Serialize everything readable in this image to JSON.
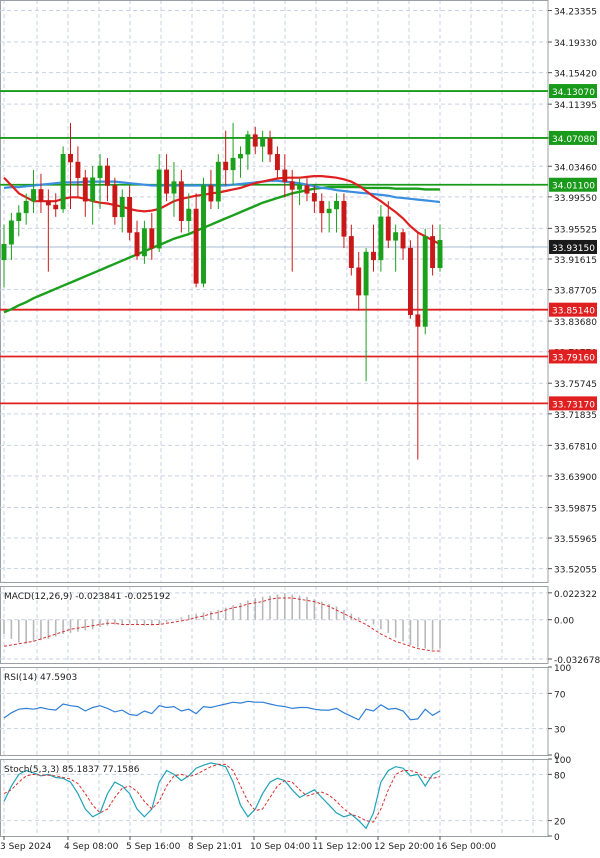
{
  "chart_data": {
    "type": "candlestick",
    "price_axis": {
      "ylim": [
        33.5035,
        34.247
      ],
      "ticks": [
        "34.23355",
        "34.19330",
        "34.15420",
        "34.11395",
        "34.07080",
        "34.03460",
        "33.99550",
        "33.95525",
        "33.91615",
        "33.87705",
        "33.83680",
        "33.79770",
        "33.75745",
        "33.71835",
        "33.67810",
        "33.63900",
        "33.59875",
        "33.55965",
        "33.52055"
      ]
    },
    "time_labels": [
      "3 Sep 2024",
      "4 Sep 08:00",
      "5 Sep 16:00",
      "8 Sep 21:01",
      "10 Sep 04:00",
      "11 Sep 12:00",
      "12 Sep 20:00",
      "16 Sep 00:00"
    ],
    "current_price": {
      "label": "33.93150",
      "value": 33.9315
    },
    "levels": [
      {
        "label": "34.13070",
        "value": 34.1307,
        "color": "#1a9a1a"
      },
      {
        "label": "34.07080",
        "value": 34.0708,
        "color": "#1a9a1a"
      },
      {
        "label": "34.01100",
        "value": 34.011,
        "color": "#1a9a1a"
      },
      {
        "label": "33.85140",
        "value": 33.8514,
        "color": "#e02020"
      },
      {
        "label": "33.79160",
        "value": 33.7916,
        "color": "#e02020"
      },
      {
        "label": "33.73170",
        "value": 33.7317,
        "color": "#e02020"
      }
    ],
    "candles": [
      [
        33.915,
        33.96,
        33.88,
        33.935
      ],
      [
        33.935,
        33.975,
        33.915,
        33.965
      ],
      [
        33.965,
        33.985,
        33.945,
        33.975
      ],
      [
        33.975,
        34.0,
        33.96,
        33.99
      ],
      [
        33.99,
        34.03,
        33.975,
        34.005
      ],
      [
        34.005,
        34.025,
        33.975,
        33.99
      ],
      [
        33.99,
        34.005,
        33.9,
        33.985
      ],
      [
        33.985,
        34.0,
        33.97,
        33.98
      ],
      [
        33.98,
        34.06,
        33.975,
        34.05
      ],
      [
        34.05,
        34.09,
        33.98,
        34.04
      ],
      [
        34.04,
        34.06,
        33.995,
        34.02
      ],
      [
        34.02,
        34.03,
        33.97,
        33.99
      ],
      [
        33.99,
        34.035,
        33.96,
        34.02
      ],
      [
        34.02,
        34.05,
        33.98,
        34.035
      ],
      [
        34.035,
        34.045,
        33.99,
        34.01
      ],
      [
        34.01,
        34.02,
        33.96,
        33.97
      ],
      [
        33.97,
        34.005,
        33.95,
        33.995
      ],
      [
        33.995,
        34.01,
        33.94,
        33.95
      ],
      [
        33.95,
        33.965,
        33.915,
        33.92
      ],
      [
        33.92,
        33.965,
        33.91,
        33.955
      ],
      [
        33.955,
        33.975,
        33.915,
        33.93
      ],
      [
        33.93,
        34.05,
        33.925,
        34.03
      ],
      [
        34.03,
        34.05,
        33.99,
        34.0
      ],
      [
        34.0,
        34.04,
        33.97,
        34.015
      ],
      [
        34.015,
        34.03,
        33.95,
        33.965
      ],
      [
        33.965,
        34.0,
        33.95,
        33.98
      ],
      [
        33.98,
        34.0,
        33.88,
        33.885
      ],
      [
        33.885,
        34.02,
        33.88,
        34.01
      ],
      [
        34.01,
        34.03,
        33.98,
        33.99
      ],
      [
        33.99,
        34.05,
        33.98,
        34.04
      ],
      [
        34.04,
        34.08,
        34.01,
        34.03
      ],
      [
        34.03,
        34.09,
        34.01,
        34.045
      ],
      [
        34.045,
        34.06,
        34.02,
        34.05
      ],
      [
        34.05,
        34.08,
        34.03,
        34.075
      ],
      [
        34.075,
        34.085,
        34.05,
        34.06
      ],
      [
        34.06,
        34.08,
        34.04,
        34.07
      ],
      [
        34.07,
        34.08,
        34.04,
        34.05
      ],
      [
        34.05,
        34.06,
        34.02,
        34.03
      ],
      [
        34.03,
        34.05,
        33.995,
        34.015
      ],
      [
        34.015,
        34.03,
        33.9,
        34.005
      ],
      [
        34.005,
        34.02,
        33.985,
        34.01
      ],
      [
        34.01,
        34.02,
        33.99,
        34.0
      ],
      [
        34.0,
        34.01,
        33.975,
        33.99
      ],
      [
        33.99,
        34.0,
        33.95,
        33.975
      ],
      [
        33.975,
        33.99,
        33.95,
        33.98
      ],
      [
        33.98,
        34.0,
        33.95,
        33.99
      ],
      [
        33.99,
        34.0,
        33.93,
        33.945
      ],
      [
        33.945,
        33.96,
        33.895,
        33.905
      ],
      [
        33.905,
        33.925,
        33.85,
        33.87
      ],
      [
        33.87,
        33.93,
        33.76,
        33.925
      ],
      [
        33.925,
        33.96,
        33.9,
        33.915
      ],
      [
        33.915,
        33.985,
        33.9,
        33.97
      ],
      [
        33.97,
        33.99,
        33.93,
        33.94
      ],
      [
        33.94,
        33.96,
        33.9,
        33.95
      ],
      [
        33.95,
        33.955,
        33.915,
        33.93
      ],
      [
        33.93,
        33.94,
        33.84,
        33.845
      ],
      [
        33.845,
        33.95,
        33.66,
        33.83
      ],
      [
        33.83,
        33.955,
        33.82,
        33.945
      ],
      [
        33.945,
        33.96,
        33.895,
        33.905
      ],
      [
        33.905,
        33.96,
        33.9,
        33.94
      ]
    ],
    "ma_red": [
      34.02,
      34.01,
      34.0,
      33.995,
      33.99,
      33.99,
      33.99,
      33.99,
      33.993,
      33.995,
      33.995,
      33.993,
      33.99,
      33.988,
      33.987,
      33.985,
      33.983,
      33.98,
      33.978,
      33.977,
      33.978,
      33.98,
      33.985,
      33.99,
      33.993,
      33.995,
      33.997,
      33.998,
      34.0,
      34.001,
      34.003,
      34.005,
      34.007,
      34.01,
      34.013,
      34.015,
      34.017,
      34.019,
      34.02,
      34.02,
      34.02,
      34.021,
      34.022,
      34.022,
      34.021,
      34.02,
      34.018,
      34.015,
      34.01,
      34.003,
      33.996,
      33.99,
      33.983,
      33.976,
      33.968,
      33.958,
      33.95,
      33.945,
      33.94,
      33.935
    ],
    "ma_blue": [
      34.007,
      34.008,
      34.008,
      34.009,
      34.01,
      34.011,
      34.012,
      34.013,
      34.014,
      34.014,
      34.014,
      34.015,
      34.015,
      34.015,
      34.015,
      34.015,
      34.014,
      34.013,
      34.012,
      34.011,
      34.01,
      34.01,
      34.01,
      34.01,
      34.01,
      34.01,
      34.01,
      34.01,
      34.01,
      34.01,
      34.01,
      34.011,
      34.012,
      34.013,
      34.014,
      34.015,
      34.016,
      34.016,
      34.015,
      34.014,
      34.013,
      34.011,
      34.009,
      34.007,
      34.006,
      34.004,
      34.003,
      34.002,
      34.001,
      34.0,
      33.999,
      33.998,
      33.997,
      33.995,
      33.994,
      33.993,
      33.992,
      33.991,
      33.99,
      33.989
    ],
    "ma_green": [
      33.848,
      33.852,
      33.857,
      33.861,
      33.866,
      33.87,
      33.874,
      33.878,
      33.882,
      33.886,
      33.89,
      33.894,
      33.898,
      33.902,
      33.906,
      33.91,
      33.914,
      33.918,
      33.922,
      33.926,
      33.93,
      33.934,
      33.938,
      33.942,
      33.945,
      33.948,
      33.952,
      33.956,
      33.96,
      33.964,
      33.968,
      33.972,
      33.976,
      33.98,
      33.984,
      33.988,
      33.991,
      33.994,
      33.997,
      34.0,
      34.002,
      34.004,
      34.006,
      34.007,
      34.008,
      34.008,
      34.008,
      34.008,
      34.008,
      34.007,
      34.007,
      34.007,
      34.007,
      34.006,
      34.006,
      34.006,
      34.006,
      34.005,
      34.005,
      34.005
    ],
    "macd": {
      "label": "MACD(12,26,9) -0.023841 -0.025192",
      "ylim": [
        -0.036,
        0.028
      ],
      "ticks": [
        "0.022322",
        "0.00",
        "-0.032678"
      ],
      "tick_values": [
        0.022322,
        0.0,
        -0.032678
      ],
      "hist": [
        -0.012,
        -0.016,
        -0.019,
        -0.02,
        -0.018,
        -0.017,
        -0.016,
        -0.014,
        -0.012,
        -0.011,
        -0.01,
        -0.009,
        -0.008,
        -0.006,
        -0.005,
        -0.004,
        -0.004,
        -0.003,
        -0.004,
        -0.005,
        -0.005,
        -0.004,
        -0.002,
        0.0,
        0.002,
        0.004,
        0.005,
        0.006,
        0.007,
        0.008,
        0.01,
        0.012,
        0.014,
        0.016,
        0.018,
        0.019,
        0.02,
        0.021,
        0.022,
        0.021,
        0.02,
        0.019,
        0.017,
        0.015,
        0.013,
        0.011,
        0.008,
        0.005,
        0.002,
        -0.001,
        -0.004,
        -0.008,
        -0.011,
        -0.015,
        -0.018,
        -0.021,
        -0.023,
        -0.024,
        -0.025,
        -0.024
      ],
      "signal": [
        -0.022,
        -0.021,
        -0.02,
        -0.019,
        -0.018,
        -0.016,
        -0.014,
        -0.012,
        -0.01,
        -0.008,
        -0.007,
        -0.006,
        -0.005,
        -0.004,
        -0.003,
        -0.003,
        -0.004,
        -0.004,
        -0.004,
        -0.004,
        -0.004,
        -0.004,
        -0.003,
        -0.002,
        -0.001,
        0.0,
        0.002,
        0.003,
        0.005,
        0.006,
        0.008,
        0.01,
        0.011,
        0.013,
        0.014,
        0.015,
        0.017,
        0.018,
        0.018,
        0.018,
        0.017,
        0.016,
        0.015,
        0.013,
        0.011,
        0.008,
        0.005,
        0.002,
        -0.001,
        -0.004,
        -0.008,
        -0.012,
        -0.015,
        -0.018,
        -0.02,
        -0.022,
        -0.024,
        -0.025,
        -0.026,
        -0.026
      ]
    },
    "rsi": {
      "label": "RSI(14) 47.5903",
      "ylim": [
        0,
        100
      ],
      "ticks": [
        "100",
        "70",
        "30",
        "0"
      ],
      "tick_values": [
        100,
        70,
        30,
        0
      ],
      "values": [
        42,
        48,
        52,
        53,
        52,
        54,
        52,
        51,
        58,
        56,
        55,
        50,
        54,
        56,
        53,
        49,
        51,
        46,
        45,
        50,
        47,
        56,
        54,
        55,
        50,
        52,
        47,
        55,
        54,
        56,
        58,
        60,
        59,
        61,
        60,
        60,
        58,
        56,
        55,
        53,
        54,
        54,
        52,
        51,
        51,
        53,
        48,
        44,
        40,
        52,
        50,
        57,
        52,
        53,
        50,
        40,
        41,
        52,
        45,
        50
      ]
    },
    "stoch": {
      "label": "Stoch(5,3,3) 85.1837 77.1586",
      "ylim": [
        0,
        100
      ],
      "ticks": [
        "100",
        "80",
        "20",
        "0"
      ],
      "tick_values": [
        100,
        80,
        20,
        0
      ],
      "k": [
        45,
        65,
        80,
        85,
        82,
        78,
        80,
        76,
        75,
        70,
        55,
        35,
        25,
        30,
        55,
        70,
        65,
        55,
        35,
        25,
        35,
        70,
        85,
        80,
        72,
        78,
        88,
        92,
        95,
        93,
        90,
        70,
        40,
        25,
        35,
        55,
        70,
        75,
        72,
        60,
        50,
        55,
        60,
        50,
        40,
        30,
        25,
        28,
        20,
        10,
        30,
        70,
        85,
        90,
        88,
        78,
        80,
        65,
        80,
        85
      ],
      "d": [
        55,
        60,
        70,
        78,
        80,
        79,
        79,
        78,
        76,
        74,
        68,
        55,
        40,
        30,
        35,
        50,
        62,
        65,
        58,
        45,
        35,
        45,
        65,
        78,
        80,
        77,
        80,
        85,
        90,
        93,
        93,
        85,
        65,
        45,
        33,
        35,
        50,
        65,
        72,
        70,
        60,
        52,
        55,
        57,
        53,
        45,
        35,
        28,
        25,
        20,
        18,
        35,
        60,
        80,
        85,
        85,
        82,
        76,
        75,
        77
      ]
    }
  }
}
